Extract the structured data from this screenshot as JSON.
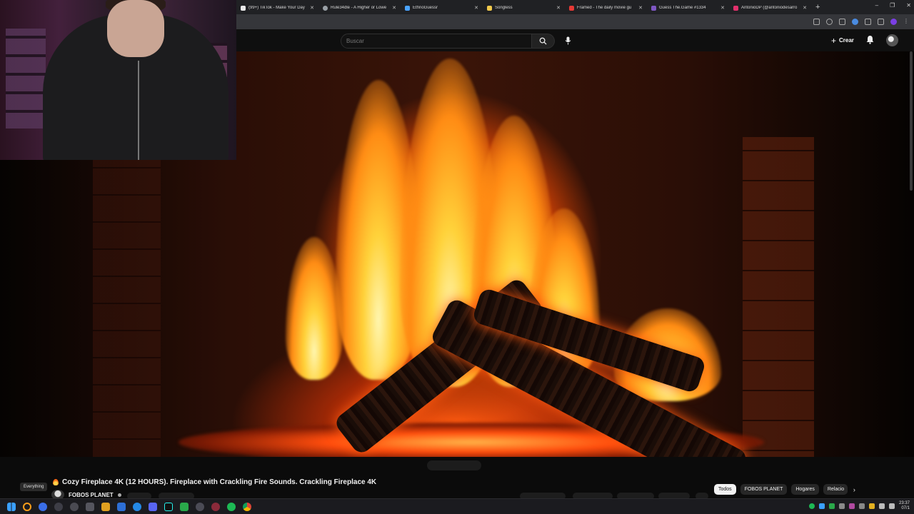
{
  "browser": {
    "tabs": [
      {
        "label": "(99+) TikTok - Make Your Day",
        "icon": "tiktok-icon",
        "color": "#e8e8e8"
      },
      {
        "label": "Rule34dle - A Higher or Lowe",
        "icon": "globe-icon",
        "color": "#9aa0a6"
      },
      {
        "label": "EthnoGuessr",
        "icon": "ethnoguessr-icon",
        "color": "#4aa3ff"
      },
      {
        "label": "Songless",
        "icon": "songless-icon",
        "color": "#f2c94c"
      },
      {
        "label": "Framed - The daily movie gu",
        "icon": "framed-icon",
        "color": "#e53935"
      },
      {
        "label": "Guess The.Game #1334",
        "icon": "guessthegame-icon",
        "color": "#7e57c2"
      },
      {
        "label": "AntonioDP (@antoniodesarro",
        "icon": "instagram-icon",
        "color": "#e1306c"
      }
    ],
    "active_tab": "youtube",
    "new_tab_label": "+",
    "window_controls": [
      "–",
      "❐",
      "✕"
    ]
  },
  "youtube": {
    "search": {
      "placeholder": "Buscar",
      "value": ""
    },
    "create_label": "Crear",
    "video": {
      "title": "Cozy Fireplace 4K (12 HOURS). Fireplace with Crackling Fire Sounds. Crackling Fireplace 4K",
      "channel": "FOBOS PLANET"
    },
    "chips": [
      "Todos",
      "FOBOS PLANET",
      "Hogares",
      "Relacio"
    ],
    "active_chip": "Todos"
  },
  "overlay": {
    "search_tooltip": "Everything"
  },
  "taskbar": {
    "apps": [
      "windows-start-icon",
      "search-icon",
      "vivaldi-icon",
      "app-icon",
      "app-icon",
      "app-icon",
      "app-icon",
      "app-icon",
      "app-icon",
      "discord-icon",
      "tiktok-icon",
      "app-icon",
      "app-icon",
      "app-icon",
      "spotify-icon",
      "chrome-icon"
    ],
    "clock_time": "23:37",
    "clock_date": "07/1"
  },
  "colors": {
    "accent_red": "#ff0000",
    "fire_orange": "#ff8a12",
    "youtube_dark": "#0f0f0f"
  }
}
